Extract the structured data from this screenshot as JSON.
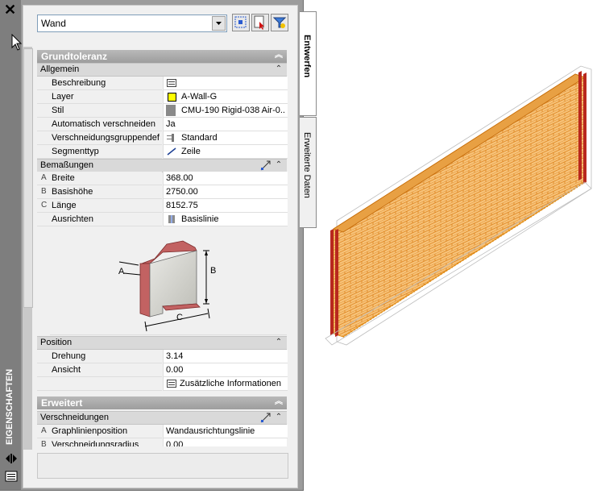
{
  "palette": {
    "title": "EIGENSCHAFTEN",
    "close_glyph": "✕",
    "tabs": [
      "Entwerfen",
      "Erweiterte Daten"
    ],
    "combo_value": "Wand",
    "toolbar_icons": [
      "select-objects-icon",
      "quick-select-icon",
      "filter-icon"
    ]
  },
  "sections": {
    "grundtoleranz": {
      "title": "Grundtoleranz",
      "allgemein": {
        "title": "Allgemein",
        "rows": [
          {
            "label": "Beschreibung",
            "value": ""
          },
          {
            "label": "Layer",
            "value": "A-Wall-G"
          },
          {
            "label": "Stil",
            "value": "CMU-190 Rigid-038 Air-0..."
          },
          {
            "label": "Automatisch verschneiden",
            "value": "Ja"
          },
          {
            "label": "Verschneidungsgruppendef",
            "value": "Standard"
          },
          {
            "label": "Segmenttyp",
            "value": "Zeile"
          }
        ]
      },
      "bemassungen": {
        "title": "Bemaßungen",
        "rows": [
          {
            "letter": "A",
            "label": "Breite",
            "value": "368.00"
          },
          {
            "letter": "B",
            "label": "Basishöhe",
            "value": "2750.00"
          },
          {
            "letter": "C",
            "label": "Länge",
            "value": "8152.75"
          },
          {
            "letter": "",
            "label": "Ausrichten",
            "value": "Basislinie"
          }
        ],
        "diagram_labels": {
          "a": "A",
          "b": "B",
          "c": "C"
        }
      },
      "position": {
        "title": "Position",
        "rows": [
          {
            "label": "Drehung",
            "value": "3.14"
          },
          {
            "label": "Ansicht",
            "value": "0.00"
          },
          {
            "label": "",
            "value": "Zusätzliche Informationen"
          }
        ]
      }
    },
    "erweitert": {
      "title": "Erweitert",
      "verschneidungen": {
        "title": "Verschneidungen",
        "rows": [
          {
            "letter": "A",
            "label": "Graphlinienposition",
            "value": "Wandausrichtungslinie"
          },
          {
            "letter": "B",
            "label": "Verschneidungsradius",
            "value": "0.00"
          }
        ]
      }
    }
  },
  "colors": {
    "layer_swatch": "#ffff00",
    "wall_orange": "#e8890c",
    "wall_red": "#b8281e"
  }
}
